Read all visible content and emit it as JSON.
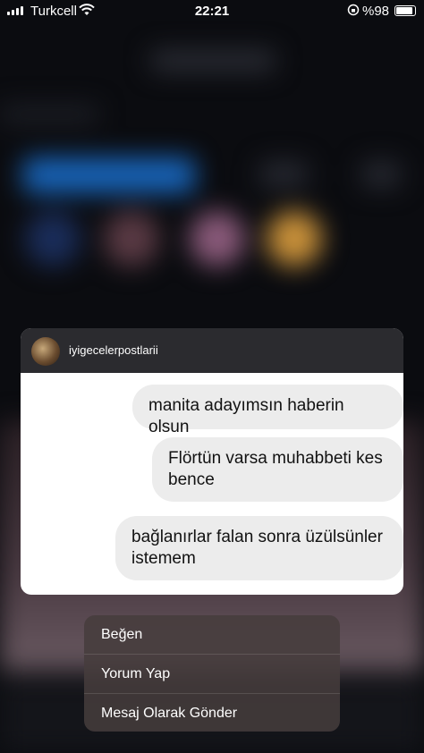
{
  "status_bar": {
    "carrier": "Turkcell",
    "time": "22:21",
    "battery": "%98"
  },
  "preview": {
    "username": "iyigecelerpostlarii",
    "messages": [
      "manita adayımsın haberin olsun",
      "Flörtün varsa muhabbeti kes bence",
      "bağlanırlar falan sonra üzülsünler istemem"
    ]
  },
  "menu": {
    "items": [
      "Beğen",
      "Yorum Yap",
      "Mesaj Olarak Gönder"
    ]
  },
  "colors": {
    "card_header": "#2b2b2f",
    "bubble": "#ececec",
    "menu_bg": "#463c3c"
  },
  "icons": [
    "signal-icon",
    "wifi-icon",
    "orientation-lock-icon",
    "battery-icon"
  ]
}
